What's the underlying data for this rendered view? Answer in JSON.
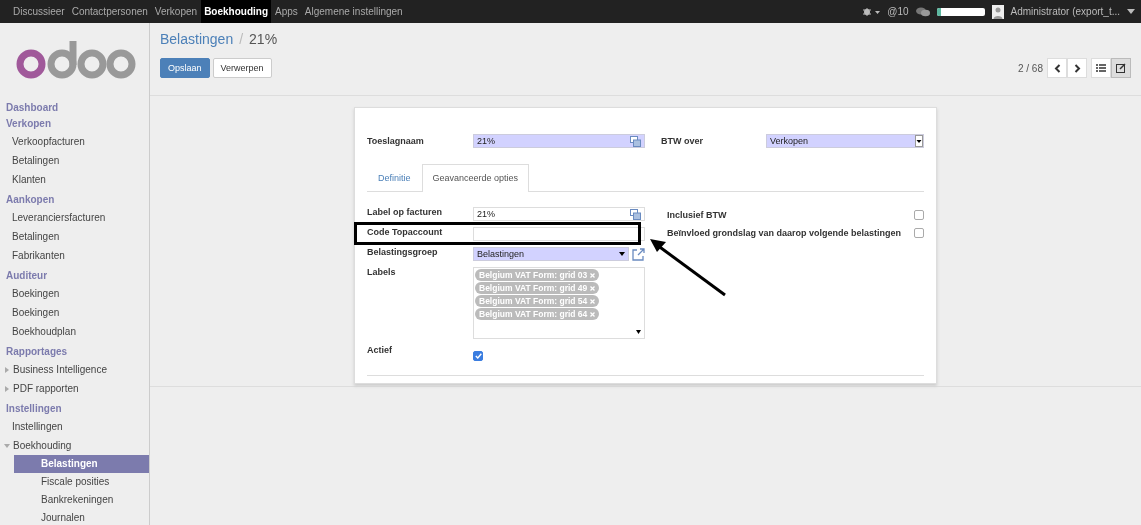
{
  "topbar": {
    "menu": [
      {
        "label": "Discussieer",
        "selected": false
      },
      {
        "label": "Contactpersonen",
        "selected": false
      },
      {
        "label": "Verkopen",
        "selected": false
      },
      {
        "label": "Boekhouding",
        "selected": true
      },
      {
        "label": "Apps",
        "selected": false
      },
      {
        "label": "Algemene instellingen",
        "selected": false
      }
    ],
    "mentions": "@10",
    "user": "Administrator (export_t..."
  },
  "sidebar": {
    "sections": [
      {
        "title": "Dashboard"
      },
      {
        "title": "Verkopen",
        "items": [
          {
            "label": "Verkoopfacturen",
            "selected": false
          },
          {
            "label": "Betalingen",
            "selected": false
          },
          {
            "label": "Klanten",
            "selected": false
          }
        ]
      },
      {
        "title": "Aankopen",
        "items": [
          {
            "label": "Leveranciersfacturen",
            "selected": false
          },
          {
            "label": "Betalingen",
            "selected": false
          },
          {
            "label": "Fabrikanten",
            "selected": false
          }
        ]
      },
      {
        "title": "Auditeur",
        "items": [
          {
            "label": "Boekingen",
            "selected": false
          },
          {
            "label": "Boekingen",
            "selected": false
          },
          {
            "label": "Boekhoudplan",
            "selected": false
          }
        ]
      },
      {
        "title": "Rapportages",
        "items": [
          {
            "label": "Business Intelligence",
            "selected": false,
            "expanded": false
          },
          {
            "label": "PDF rapporten",
            "selected": false,
            "expanded": false
          }
        ]
      },
      {
        "title": "Instellingen",
        "items": [
          {
            "label": "Instellingen",
            "selected": false
          },
          {
            "label": "Boekhouding",
            "selected": false,
            "expanded": true,
            "children": [
              {
                "label": "Belastingen",
                "selected": true
              },
              {
                "label": "Fiscale posities",
                "selected": false
              },
              {
                "label": "Bankrekeningen",
                "selected": false
              },
              {
                "label": "Journalen",
                "selected": false
              }
            ]
          }
        ]
      }
    ]
  },
  "breadcrumb": {
    "parent": "Belastingen",
    "separator": "/",
    "current": "21%"
  },
  "buttons": {
    "save": "Opslaan",
    "discard": "Verwerpen"
  },
  "pager": {
    "text": "2 / 68"
  },
  "views": [
    {
      "kind": "list",
      "selected": false
    },
    {
      "kind": "form",
      "selected": true
    }
  ],
  "form": {
    "name_label": "Toeslagnaam",
    "name_value": "21%",
    "type_label": "BTW over",
    "type_value": "Verkopen",
    "tabs": [
      {
        "label": "Definitie",
        "selected": false
      },
      {
        "label": "Geavanceerde opties",
        "selected": true
      }
    ],
    "left_fields": [
      {
        "kind": "translatable",
        "label": "Label op facturen",
        "value": "21%"
      },
      {
        "kind": "text",
        "label": "Code Topaccount"
      },
      {
        "kind": "select",
        "label": "Belastingsgroep",
        "value": "Belastingen"
      },
      {
        "kind": "tags",
        "label": "Labels",
        "tags": [
          "Belgium VAT Form: grid 03",
          "Belgium VAT Form: grid 49",
          "Belgium VAT Form: grid 54",
          "Belgium VAT Form: grid 64"
        ]
      },
      {
        "kind": "checkbox",
        "label": "Actief",
        "checked": true
      }
    ],
    "right_fields": [
      {
        "label": "Inclusief BTW",
        "checked": false
      },
      {
        "label": "Beïnvloed grondslag van daarop volgende belastingen",
        "checked": false
      }
    ]
  }
}
